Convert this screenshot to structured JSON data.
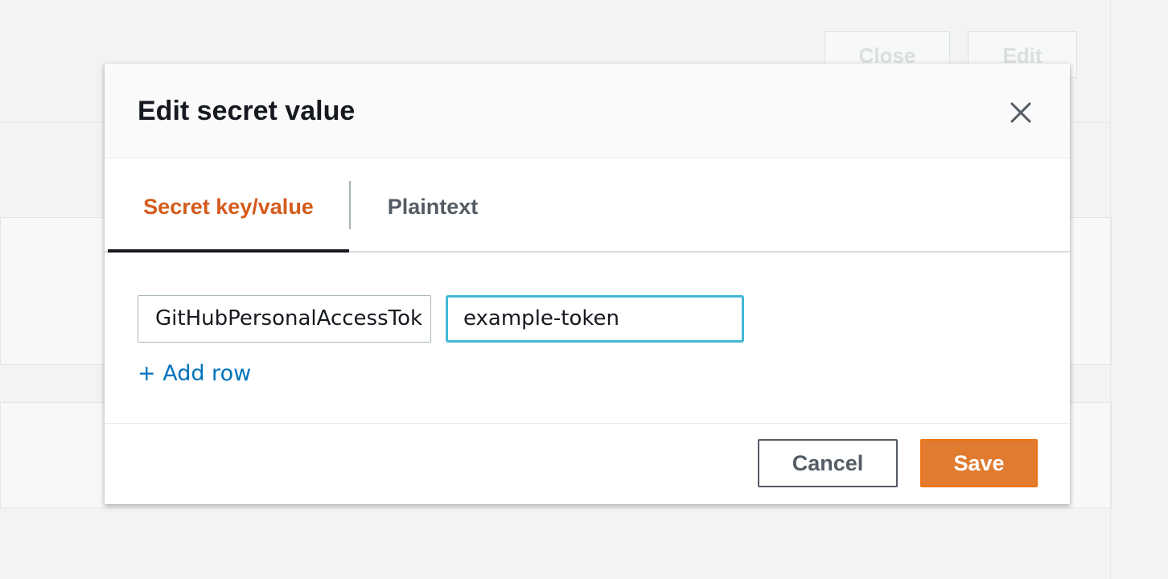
{
  "background": {
    "close_label": "Close",
    "edit_label": "Edit"
  },
  "modal": {
    "title": "Edit secret value",
    "close_icon": "close-icon",
    "tabs": [
      {
        "label": "Secret key/value",
        "active": true
      },
      {
        "label": "Plaintext",
        "active": false
      }
    ],
    "row": {
      "key": "GitHubPersonalAccessTok",
      "value": "example-token"
    },
    "add_row_label": "+ Add row",
    "cancel_label": "Cancel",
    "save_label": "Save"
  },
  "colors": {
    "accent": "#d45b1c",
    "primary_button": "#e07b2f",
    "link": "#0073bb",
    "focus_border": "#44b9d6"
  }
}
